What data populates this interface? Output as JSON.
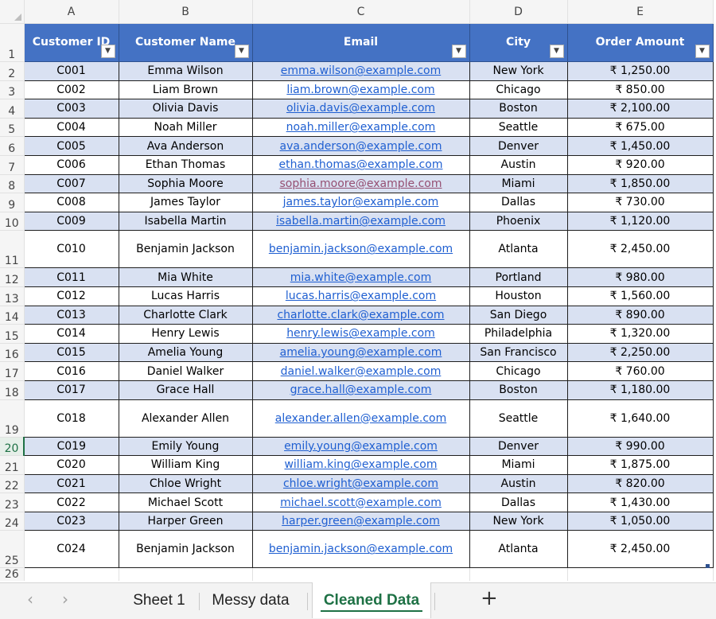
{
  "columns": [
    "A",
    "B",
    "C",
    "D",
    "E"
  ],
  "header": {
    "row_number": "1",
    "labels": [
      "Customer ID",
      "Customer Name",
      "Email",
      "City",
      "Order Amount"
    ]
  },
  "rows": [
    {
      "num": "2",
      "id": "C001",
      "name": "Emma Wilson",
      "email": "emma.wilson@example.com",
      "city": "New York",
      "amount": "₹ 1,250.00"
    },
    {
      "num": "3",
      "id": "C002",
      "name": "Liam Brown",
      "email": "liam.brown@example.com",
      "city": "Chicago",
      "amount": "₹ 850.00"
    },
    {
      "num": "4",
      "id": "C003",
      "name": "Olivia Davis",
      "email": "olivia.davis@example.com",
      "city": "Boston",
      "amount": "₹ 2,100.00"
    },
    {
      "num": "5",
      "id": "C004",
      "name": "Noah Miller",
      "email": "noah.miller@example.com",
      "city": "Seattle",
      "amount": "₹ 675.00"
    },
    {
      "num": "6",
      "id": "C005",
      "name": "Ava Anderson",
      "email": "ava.anderson@example.com",
      "city": "Denver",
      "amount": "₹ 1,450.00"
    },
    {
      "num": "7",
      "id": "C006",
      "name": "Ethan Thomas",
      "email": "ethan.thomas@example.com",
      "city": "Austin",
      "amount": "₹ 920.00"
    },
    {
      "num": "8",
      "id": "C007",
      "name": "Sophia Moore",
      "email": "sophia.moore@example.com",
      "city": "Miami",
      "amount": "₹ 1,850.00",
      "visited": true
    },
    {
      "num": "9",
      "id": "C008",
      "name": "James Taylor",
      "email": "james.taylor@example.com",
      "city": "Dallas",
      "amount": "₹ 730.00"
    },
    {
      "num": "10",
      "id": "C009",
      "name": "Isabella Martin",
      "email": "isabella.martin@example.com",
      "city": "Phoenix",
      "amount": "₹ 1,120.00"
    },
    {
      "num": "11",
      "id": "C010",
      "name": "Benjamin Jackson",
      "email": "benjamin.jackson@example.com",
      "city": "Atlanta",
      "amount": "₹ 2,450.00",
      "tall": true
    },
    {
      "num": "12",
      "id": "C011",
      "name": "Mia White",
      "email": "mia.white@example.com",
      "city": "Portland",
      "amount": "₹ 980.00"
    },
    {
      "num": "13",
      "id": "C012",
      "name": "Lucas Harris",
      "email": "lucas.harris@example.com",
      "city": "Houston",
      "amount": "₹ 1,560.00"
    },
    {
      "num": "14",
      "id": "C013",
      "name": "Charlotte Clark",
      "email": "charlotte.clark@example.com",
      "city": "San Diego",
      "amount": "₹ 890.00"
    },
    {
      "num": "15",
      "id": "C014",
      "name": "Henry Lewis",
      "email": "henry.lewis@example.com",
      "city": "Philadelphia",
      "amount": "₹ 1,320.00"
    },
    {
      "num": "16",
      "id": "C015",
      "name": "Amelia Young",
      "email": "amelia.young@example.com",
      "city": "San Francisco",
      "amount": "₹ 2,250.00"
    },
    {
      "num": "17",
      "id": "C016",
      "name": "Daniel Walker",
      "email": "daniel.walker@example.com",
      "city": "Chicago",
      "amount": "₹ 760.00"
    },
    {
      "num": "18",
      "id": "C017",
      "name": "Grace Hall",
      "email": "grace.hall@example.com",
      "city": "Boston",
      "amount": "₹ 1,180.00"
    },
    {
      "num": "19",
      "id": "C018",
      "name": "Alexander Allen",
      "email": "alexander.allen@example.com",
      "city": "Seattle",
      "amount": "₹ 1,640.00",
      "tall": true
    },
    {
      "num": "20",
      "id": "C019",
      "name": "Emily Young",
      "email": "emily.young@example.com",
      "city": "Denver",
      "amount": "₹ 990.00",
      "selected": true
    },
    {
      "num": "21",
      "id": "C020",
      "name": "William King",
      "email": "william.king@example.com",
      "city": "Miami",
      "amount": "₹ 1,875.00"
    },
    {
      "num": "22",
      "id": "C021",
      "name": "Chloe Wright",
      "email": "chloe.wright@example.com",
      "city": "Austin",
      "amount": "₹ 820.00"
    },
    {
      "num": "23",
      "id": "C022",
      "name": "Michael Scott",
      "email": "michael.scott@example.com",
      "city": "Dallas",
      "amount": "₹ 1,430.00"
    },
    {
      "num": "24",
      "id": "C023",
      "name": "Harper Green",
      "email": "harper.green@example.com",
      "city": "New York",
      "amount": "₹ 1,050.00"
    },
    {
      "num": "25",
      "id": "C024",
      "name": "Benjamin Jackson",
      "email": "benjamin.jackson@example.com",
      "city": "Atlanta",
      "amount": "₹ 2,450.00",
      "tall": true
    }
  ],
  "partial_row": "26",
  "tabs": {
    "prev_icon": "‹",
    "next_icon": "›",
    "items": [
      "Sheet 1",
      "Messy data",
      "Cleaned Data"
    ],
    "active": "Cleaned Data",
    "add_icon": "+"
  },
  "colors": {
    "header_fill": "#4472c4",
    "band_fill": "#d9e1f2",
    "link": "#1f5fd1",
    "visited_link": "#954f72",
    "accent": "#1e7145"
  }
}
